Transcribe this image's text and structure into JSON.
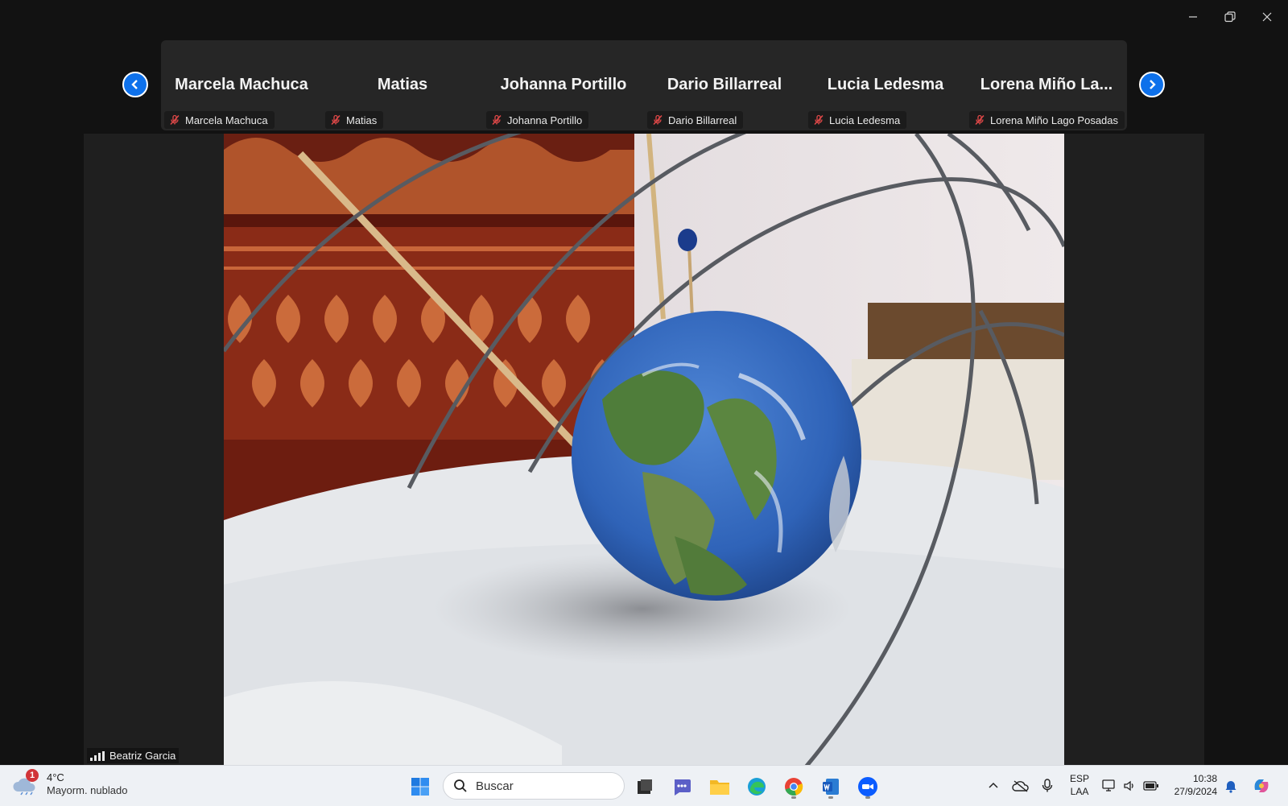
{
  "participants": [
    {
      "display_name": "Marcela Machuca",
      "label": "Marcela Machuca"
    },
    {
      "display_name": "Matias",
      "label": "Matias"
    },
    {
      "display_name": "Johanna Portillo",
      "label": "Johanna Portillo"
    },
    {
      "display_name": "Dario Billarreal",
      "label": "Dario Billarreal"
    },
    {
      "display_name": "Lucia Ledesma",
      "label": "Lucia Ledesma"
    },
    {
      "display_name": "Lorena Miño La...",
      "label": "Lorena Miño Lago Posadas"
    }
  ],
  "active_speaker": {
    "name": "Beatriz Garcia"
  },
  "taskbar": {
    "weather_temp": "4°C",
    "weather_desc": "Mayorm. nublado",
    "weather_badge": "1",
    "search_placeholder": "Buscar",
    "lang_line1": "ESP",
    "lang_line2": "LAA",
    "time": "10:38",
    "date": "27/9/2024"
  },
  "colors": {
    "accent": "#0e71eb",
    "muted_mic": "#e04848",
    "strip_bg": "#262626",
    "stage_bg": "#1f1f1f",
    "taskbar_bg": "#eef1f5"
  },
  "icons": [
    "minimize-icon",
    "restore-icon",
    "close-icon",
    "chevron-left-icon",
    "chevron-right-icon",
    "mic-muted-icon",
    "signal-icon",
    "cloud-icon",
    "windows-icon",
    "search-icon",
    "file-manager-icon",
    "teams-icon",
    "folder-icon",
    "edge-icon",
    "chrome-icon",
    "word-icon",
    "zoom-icon",
    "chevron-up-icon",
    "onedrive-icon",
    "microphone-icon",
    "network-icon",
    "volume-icon",
    "battery-icon",
    "bell-icon",
    "copilot-icon"
  ]
}
